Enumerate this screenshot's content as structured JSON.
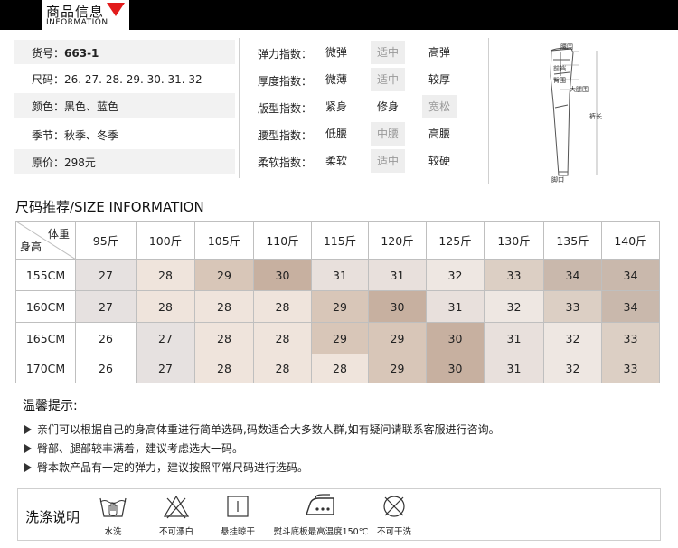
{
  "header": {
    "title": "商品信息",
    "subtitle": "INFORMATION"
  },
  "info": {
    "rows": [
      {
        "label": "货号：",
        "value": "663-1"
      },
      {
        "label": "尺码：",
        "value": "26. 27. 28. 29. 30. 31. 32"
      },
      {
        "label": "颜色：",
        "value": "黑色、蓝色"
      },
      {
        "label": "季节：",
        "value": "秋季、冬季"
      },
      {
        "label": "原价：",
        "value": "298元"
      }
    ],
    "indices": [
      {
        "label": "弹力指数：",
        "options": [
          "微弹",
          "适中",
          "高弹"
        ],
        "selected": 1
      },
      {
        "label": "厚度指数：",
        "options": [
          "微薄",
          "适中",
          "较厚"
        ],
        "selected": 1
      },
      {
        "label": "版型指数：",
        "options": [
          "紧身",
          "修身",
          "宽松"
        ],
        "selected": 2
      },
      {
        "label": "腰型指数：",
        "options": [
          "低腰",
          "中腰",
          "高腰"
        ],
        "selected": 1
      },
      {
        "label": "柔软指数：",
        "options": [
          "柔软",
          "适中",
          "较硬"
        ],
        "selected": 1
      }
    ]
  },
  "diagram": {
    "labels": {
      "waist": "腰围",
      "front_rise": "前裆",
      "hip": "臀围",
      "thigh": "大腿围",
      "length": "裤长",
      "hem": "脚口"
    }
  },
  "size": {
    "title": "尺码推荐/SIZE INFORMATION",
    "corner_weight": "体重",
    "corner_height": "身高",
    "weights": [
      "95斤",
      "100斤",
      "105斤",
      "110斤",
      "115斤",
      "120斤",
      "125斤",
      "130斤",
      "135斤",
      "140斤"
    ],
    "rows": [
      {
        "height": "155CM",
        "values": [
          "27",
          "28",
          "29",
          "30",
          "31",
          "31",
          "32",
          "33",
          "34",
          "34"
        ]
      },
      {
        "height": "160CM",
        "values": [
          "27",
          "28",
          "28",
          "28",
          "29",
          "30",
          "31",
          "32",
          "33",
          "34"
        ]
      },
      {
        "height": "165CM",
        "values": [
          "26",
          "27",
          "28",
          "28",
          "29",
          "29",
          "30",
          "31",
          "32",
          "33"
        ]
      },
      {
        "height": "170CM",
        "values": [
          "26",
          "27",
          "28",
          "28",
          "28",
          "29",
          "30",
          "31",
          "32",
          "33"
        ]
      }
    ],
    "colors": {
      "26": "#ffffff",
      "27": "#e6e1e0",
      "28": "#efe4dc",
      "29": "#d8c6b8",
      "30": "#c7b0a0",
      "31": "#e8e0dc",
      "32": "#eee7e2",
      "33": "#dccfc4",
      "34": "#c9b8ac"
    }
  },
  "tips": {
    "title": "温馨提示:",
    "items": [
      "亲们可以根据自己的身高体重进行简单选码,码数适合大多数人群,如有疑问请联系客服进行咨询。",
      "臀部、腿部较丰满着，建议考虑选大一码。",
      "臀本款产品有一定的弹力，建议按照平常尺码进行选码。"
    ]
  },
  "wash": {
    "title": "洗涤说明",
    "items": [
      {
        "icon": "hand-wash-icon",
        "label": "水洗"
      },
      {
        "icon": "no-bleach-icon",
        "label": "不可漂白"
      },
      {
        "icon": "hang-dry-icon",
        "label": "悬挂晾干"
      },
      {
        "icon": "iron-icon",
        "label": "熨斗底板最高温度150℃"
      },
      {
        "icon": "no-tumble-dry-icon",
        "label": "不可干洗"
      }
    ]
  }
}
